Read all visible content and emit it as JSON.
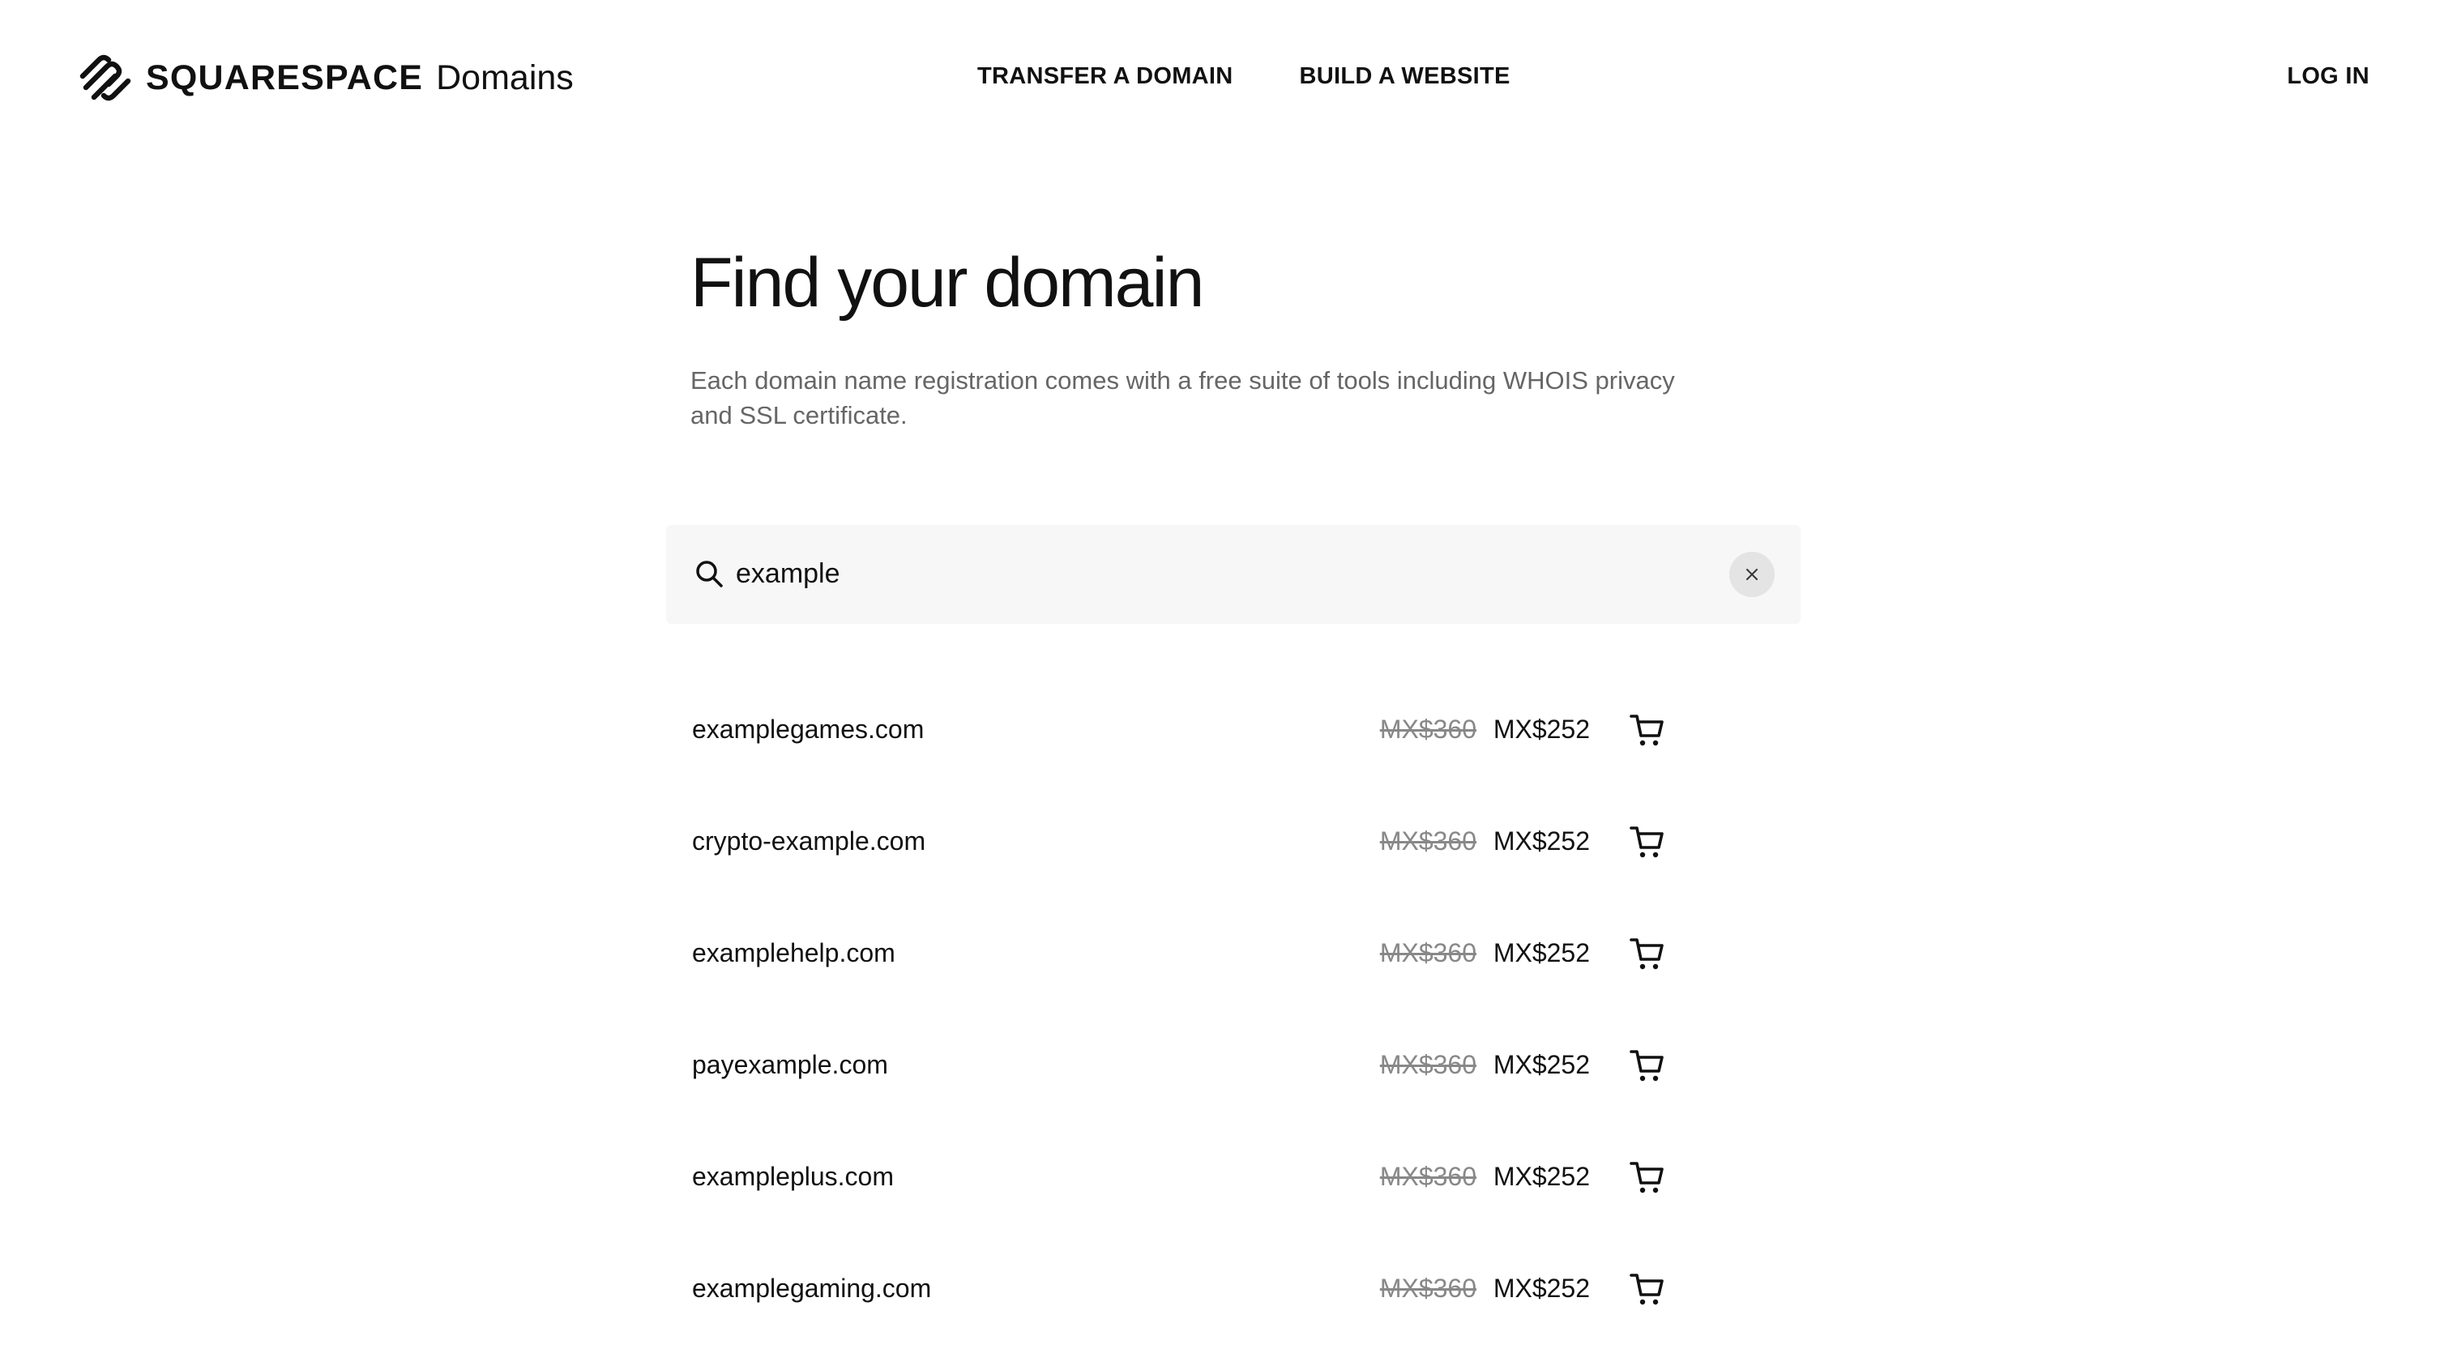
{
  "header": {
    "brand_name": "SQUARESPACE",
    "brand_product": "Domains",
    "nav": [
      {
        "label": "TRANSFER A DOMAIN"
      },
      {
        "label": "BUILD A WEBSITE"
      }
    ],
    "login_label": "LOG IN"
  },
  "hero": {
    "title": "Find your domain",
    "subtitle": "Each domain name registration comes with a free suite of tools including WHOIS privacy and SSL certificate."
  },
  "search": {
    "value": "example"
  },
  "results": [
    {
      "domain": "examplegames.com",
      "old_price": "MX$360",
      "price": "MX$252"
    },
    {
      "domain": "crypto-example.com",
      "old_price": "MX$360",
      "price": "MX$252"
    },
    {
      "domain": "examplehelp.com",
      "old_price": "MX$360",
      "price": "MX$252"
    },
    {
      "domain": "payexample.com",
      "old_price": "MX$360",
      "price": "MX$252"
    },
    {
      "domain": "exampleplus.com",
      "old_price": "MX$360",
      "price": "MX$252"
    },
    {
      "domain": "examplegaming.com",
      "old_price": "MX$360",
      "price": "MX$252"
    }
  ],
  "icons": {
    "logo": "squarespace-logo-icon",
    "search": "search-icon",
    "clear": "close-icon",
    "cart": "cart-icon"
  },
  "colors": {
    "text": "#111111",
    "muted": "#666666",
    "strike": "#888888",
    "search_bg": "#f7f7f7",
    "clear_bg": "#e4e4e4"
  }
}
